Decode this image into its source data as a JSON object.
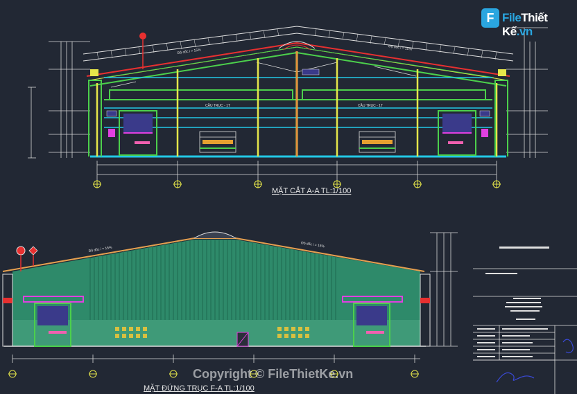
{
  "logo": {
    "letter": "F",
    "name_part1": "File",
    "name_part2": "Thiết Kế",
    "suffix": ".vn"
  },
  "section_title": "MẶT CẮT A-A  TL:1/100",
  "elevation_title": "MẶT ĐỨNG TRỤC F-A  TL:1/100",
  "watermark": "Copyright © FileThietKe.vn",
  "crane_label_left": "CẦU TRỤC - 1T",
  "crane_label_right": "CẦU TRỤC - 1T",
  "slope_label": "Độ dốc i = 15%",
  "colors": {
    "background": "#222834",
    "roof_red": "#e83030",
    "frame_green": "#4cd04c",
    "wall_green": "#2e8a6a",
    "column_yellow": "#e6e64a",
    "beam_cyan": "#22c8e6",
    "magenta": "#e040e0"
  },
  "icons": [
    "axis-marker-icon",
    "elevation-marker-icon",
    "signature-icon"
  ]
}
